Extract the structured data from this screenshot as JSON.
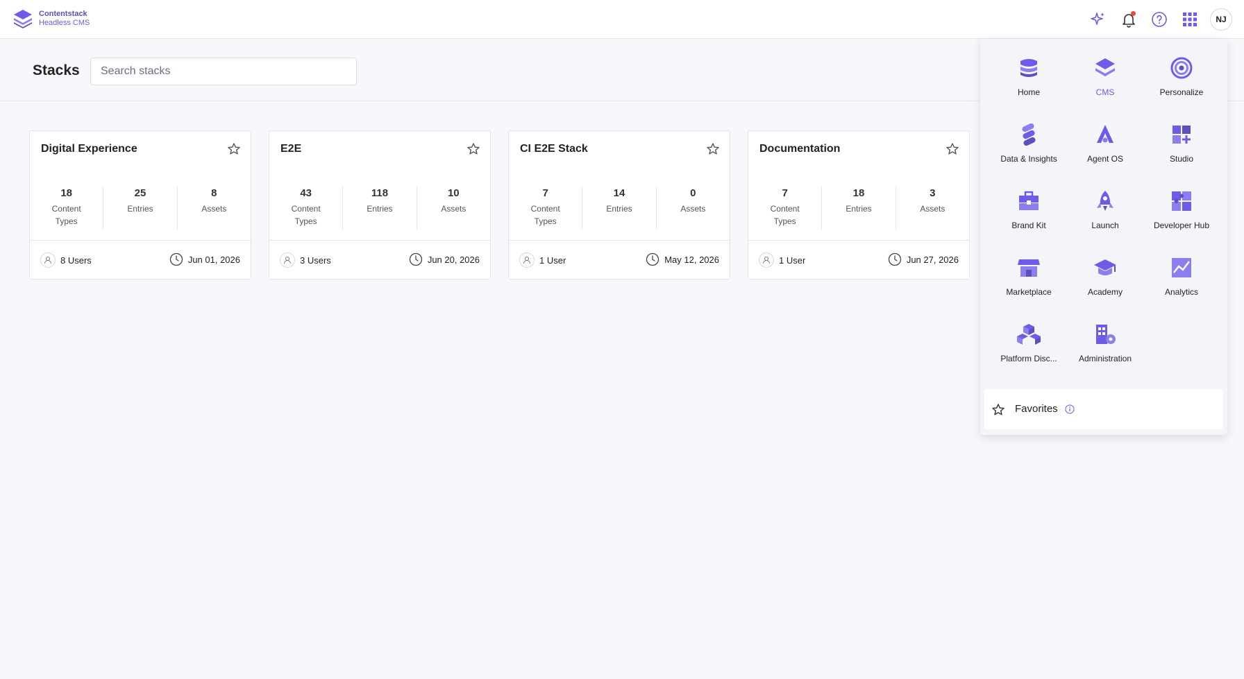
{
  "brand": {
    "title": "Contentstack",
    "subtitle": "Headless CMS",
    "accent": "#6c5ce7"
  },
  "header": {
    "icons": [
      "sparkle-icon",
      "bell-icon",
      "help-icon",
      "apps-grid-icon"
    ],
    "avatar_initials": "NJ",
    "notification_color": "#e74c3c"
  },
  "page": {
    "title": "Stacks",
    "search_placeholder": "Search stacks"
  },
  "stacks": [
    {
      "name": "Digital Experience",
      "content_types": "18",
      "entries": "25",
      "assets": "8",
      "users": "8 Users",
      "date": "Jun 01, 2026"
    },
    {
      "name": "E2E",
      "content_types": "43",
      "entries": "118",
      "assets": "10",
      "users": "3 Users",
      "date": "Jun 20, 2026"
    },
    {
      "name": "CI E2E Stack",
      "content_types": "7",
      "entries": "14",
      "assets": "0",
      "users": "1 User",
      "date": "May 12, 2026"
    },
    {
      "name": "Documentation",
      "content_types": "7",
      "entries": "18",
      "assets": "3",
      "users": "1 User",
      "date": "Jun 27, 2026"
    }
  ],
  "stat_labels": {
    "content_types_line1": "Content",
    "content_types_line2": "Types",
    "entries": "Entries",
    "assets": "Assets"
  },
  "apps_menu": {
    "items": [
      {
        "label": "Home",
        "icon": "home-stack-icon"
      },
      {
        "label": "CMS",
        "icon": "cms-layers-icon",
        "active": true
      },
      {
        "label": "Personalize",
        "icon": "target-icon"
      },
      {
        "label": "Data & Insights",
        "icon": "data-insights-icon"
      },
      {
        "label": "Agent OS",
        "icon": "agent-os-icon"
      },
      {
        "label": "Studio",
        "icon": "studio-grid-icon"
      },
      {
        "label": "Brand Kit",
        "icon": "briefcase-icon"
      },
      {
        "label": "Launch",
        "icon": "rocket-icon"
      },
      {
        "label": "Developer Hub",
        "icon": "puzzle-icon"
      },
      {
        "label": "Marketplace",
        "icon": "store-icon"
      },
      {
        "label": "Academy",
        "icon": "graduation-cap-icon"
      },
      {
        "label": "Analytics",
        "icon": "chart-line-icon"
      },
      {
        "label": "Platform Disc...",
        "icon": "platform-cubes-icon"
      },
      {
        "label": "Administration",
        "icon": "admin-building-icon"
      }
    ],
    "favorites_label": "Favorites"
  }
}
